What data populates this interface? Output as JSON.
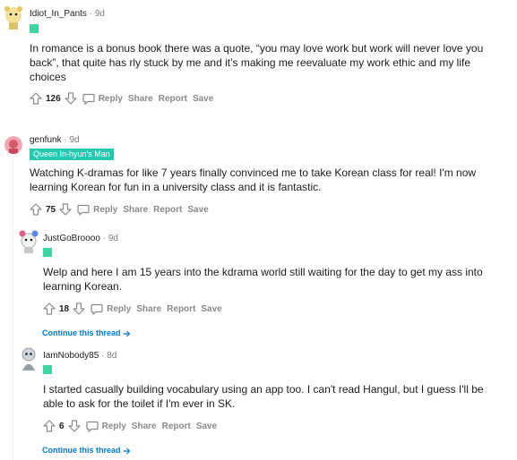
{
  "comments": [
    {
      "username": "Idiot_In_Pants",
      "age": "9d",
      "flair": "",
      "body": "In romance is a bonus book there was a quote, “you may love work but work will never love you back”, that quite has rly stuck by me and it’s making me reevaluate my work ethic and my life choices",
      "score": "126"
    },
    {
      "username": "genfunk",
      "age": "9d",
      "flair": "Queen In-hyun's Man",
      "body": "Watching K-dramas for like 7 years finally convinced me to take Korean class for real! I'm now learning Korean for fun in a university class and it is fantastic.",
      "score": "75"
    },
    {
      "username": "JustGoBroooo",
      "age": "9d",
      "flair": "",
      "body": "Welp and here I am 15 years into the kdrama world still waiting for the day to get my ass into learning Korean.",
      "score": "18",
      "continue": "Continue this thread"
    },
    {
      "username": "IamNobody85",
      "age": "8d",
      "flair": "",
      "body": "I started casually building vocabulary using an app too. I can't read Hangul, but I guess I'll be able to ask for the toilet if I'm ever in SK.",
      "score": "6",
      "continue": "Continue this thread"
    }
  ],
  "actions": {
    "reply": "Reply",
    "share": "Share",
    "report": "Report",
    "save": "Save"
  },
  "separator": "·",
  "colors": {
    "flair_badge": "#25c9b2",
    "flair_dot": "#3fd4a0",
    "link": "#0079d3",
    "meta": "#878a8c"
  }
}
